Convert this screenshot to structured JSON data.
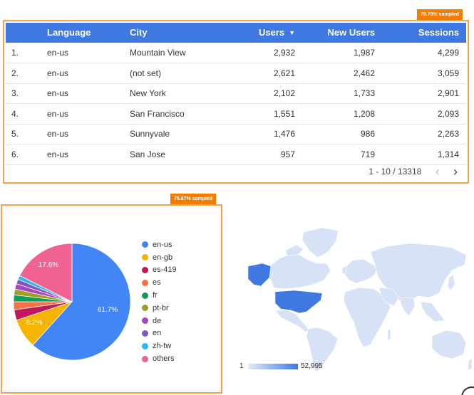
{
  "table": {
    "sample_badge": "79.78% sampled",
    "headers": {
      "language": "Language",
      "city": "City",
      "users": "Users",
      "new_users": "New Users",
      "sessions": "Sessions"
    },
    "rows": [
      {
        "num": "1.",
        "language": "en-us",
        "city": "Mountain View",
        "users": "2,932",
        "new_users": "1,987",
        "sessions": "4,299"
      },
      {
        "num": "2.",
        "language": "en-us",
        "city": "(not set)",
        "users": "2,621",
        "new_users": "2,462",
        "sessions": "3,059"
      },
      {
        "num": "3.",
        "language": "en-us",
        "city": "New York",
        "users": "2,102",
        "new_users": "1,733",
        "sessions": "2,901"
      },
      {
        "num": "4.",
        "language": "en-us",
        "city": "San Francisco",
        "users": "1,551",
        "new_users": "1,208",
        "sessions": "2,093"
      },
      {
        "num": "5.",
        "language": "en-us",
        "city": "Sunnyvale",
        "users": "1,476",
        "new_users": "986",
        "sessions": "2,263"
      },
      {
        "num": "6.",
        "language": "en-us",
        "city": "San Jose",
        "users": "957",
        "new_users": "719",
        "sessions": "1,314"
      }
    ],
    "pagination": "1 - 10 / 13318",
    "sort_icon": "caret-down-icon",
    "prev_icon": "chevron-left-icon",
    "next_icon": "chevron-right-icon"
  },
  "pie": {
    "sample_badge": "75.87% sampled",
    "label_en_us": "61.7%",
    "label_en_gb": "8.2%",
    "label_others": "17.6%"
  },
  "chart_data": {
    "type": "pie",
    "categories": [
      "en-us",
      "en-gb",
      "es-419",
      "es",
      "fr",
      "pt-br",
      "de",
      "en",
      "zh-tw",
      "others"
    ],
    "values": [
      61.7,
      8.2,
      2.9,
      2.2,
      1.9,
      1.6,
      1.5,
      1.3,
      1.1,
      17.6
    ],
    "colors": [
      "#4285f4",
      "#f4b400",
      "#c2185b",
      "#ff7043",
      "#0f9d58",
      "#9e9d24",
      "#ab47bc",
      "#7e57c2",
      "#29b6f6",
      "#f06292"
    ]
  },
  "map": {
    "scale_min": "1",
    "scale_max": "52,995",
    "colors": {
      "low": "#dbe5f8",
      "high": "#3f78e0"
    }
  }
}
